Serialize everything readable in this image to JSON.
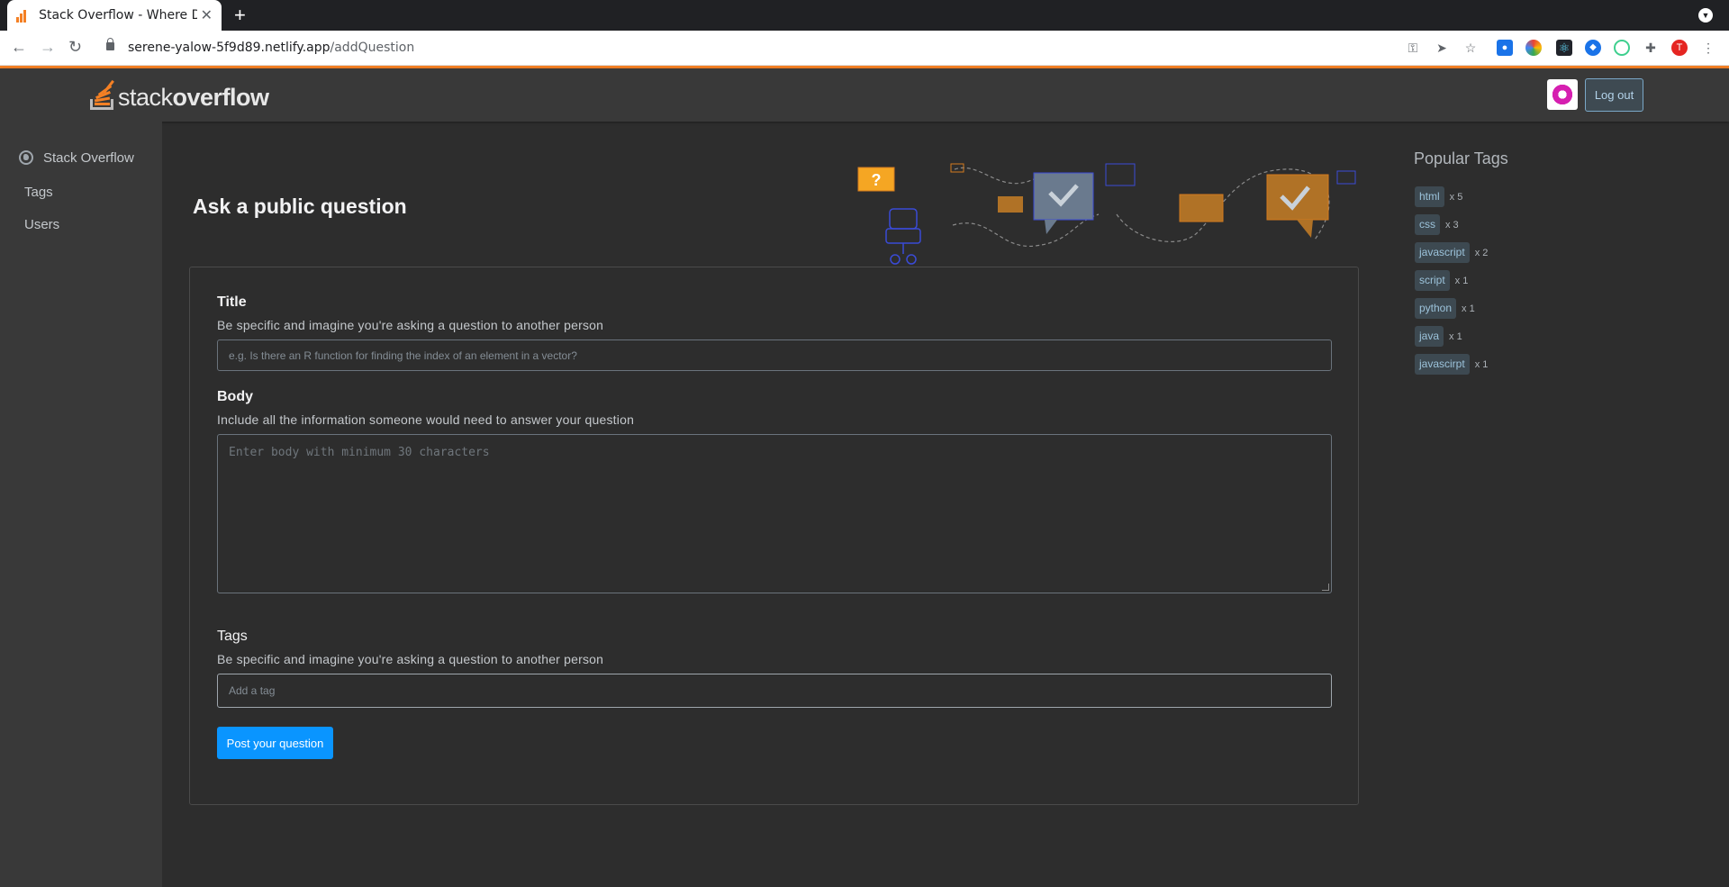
{
  "browser": {
    "tab_title": "Stack Overflow - Where D",
    "new_tab": "+",
    "url_host": "serene-yalow-5f9d89.netlify.app",
    "url_path": "/addQuestion",
    "profile_initial": "T"
  },
  "header": {
    "logo_text_light": "stack",
    "logo_text_bold": "overflow",
    "logout_label": "Log out"
  },
  "sidebar": {
    "items": [
      {
        "label": "Stack Overflow"
      },
      {
        "label": "Tags"
      },
      {
        "label": "Users"
      }
    ]
  },
  "main": {
    "title": "Ask a public question",
    "title_label": "Title",
    "title_help": "Be specific and imagine you're asking a question to another person",
    "title_placeholder": "e.g. Is there an R function for finding the index of an element in a vector?",
    "body_label": "Body",
    "body_help": "Include all the information someone would need to answer your question",
    "body_placeholder": "Enter body with minimum 30 characters",
    "tags_label": "Tags",
    "tags_help": "Be specific and imagine you're asking a question to another person",
    "tags_placeholder": "Add a tag",
    "post_button": "Post your question"
  },
  "popular_tags": {
    "title": "Popular Tags",
    "items": [
      {
        "name": "html",
        "count": "x 5"
      },
      {
        "name": "css",
        "count": "x 3"
      },
      {
        "name": "javascript",
        "count": "x 2"
      },
      {
        "name": "script",
        "count": "x 1"
      },
      {
        "name": "python",
        "count": "x 1"
      },
      {
        "name": "java",
        "count": "x 1"
      },
      {
        "name": "javascirpt",
        "count": "x 1"
      }
    ]
  },
  "colors": {
    "accent": "#f48024",
    "primary_button": "#0a95ff",
    "background": "#2d2d2d",
    "header_bg": "#393939"
  }
}
